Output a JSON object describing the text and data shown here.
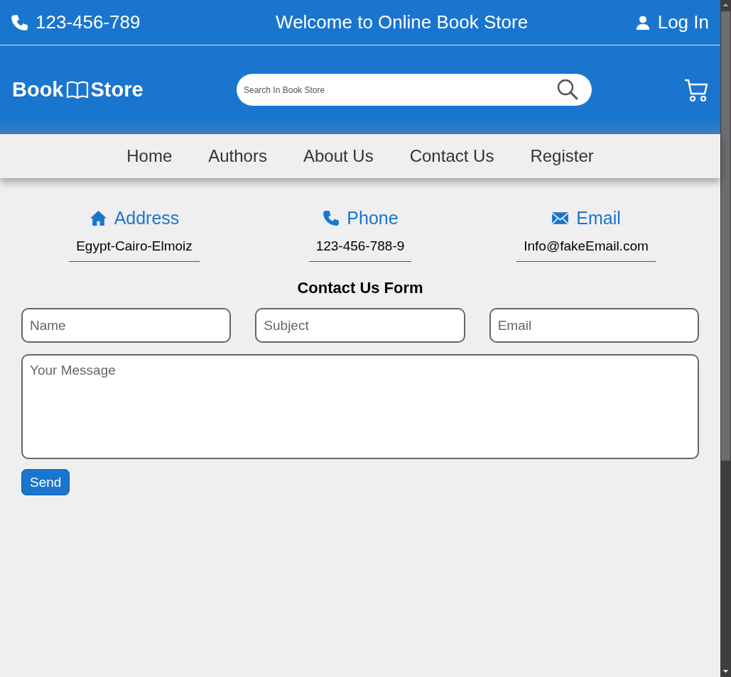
{
  "top_bar": {
    "phone": "123-456-789",
    "welcome": "Welcome to Online Book Store",
    "login": "Log In"
  },
  "header": {
    "logo_first": "Book",
    "logo_second": "Store",
    "search": {
      "placeholder": "Search In Book Store"
    }
  },
  "nav": [
    {
      "label": "Home"
    },
    {
      "label": "Authors"
    },
    {
      "label": "About Us"
    },
    {
      "label": "Contact Us"
    },
    {
      "label": "Register"
    }
  ],
  "contact_info": [
    {
      "kind": "address",
      "title": "Address",
      "value": "Egypt-Cairo-Elmoiz"
    },
    {
      "kind": "phone",
      "title": "Phone",
      "value": "123-456-788-9"
    },
    {
      "kind": "email",
      "title": "Email",
      "value": "Info@fakeEmail.com"
    }
  ],
  "form": {
    "title": "Contact Us Form",
    "fields": [
      {
        "placeholder": "Name"
      },
      {
        "placeholder": "Subject"
      },
      {
        "placeholder": "Email"
      }
    ],
    "message": {
      "placeholder": "Your Message"
    },
    "send": "Send"
  }
}
